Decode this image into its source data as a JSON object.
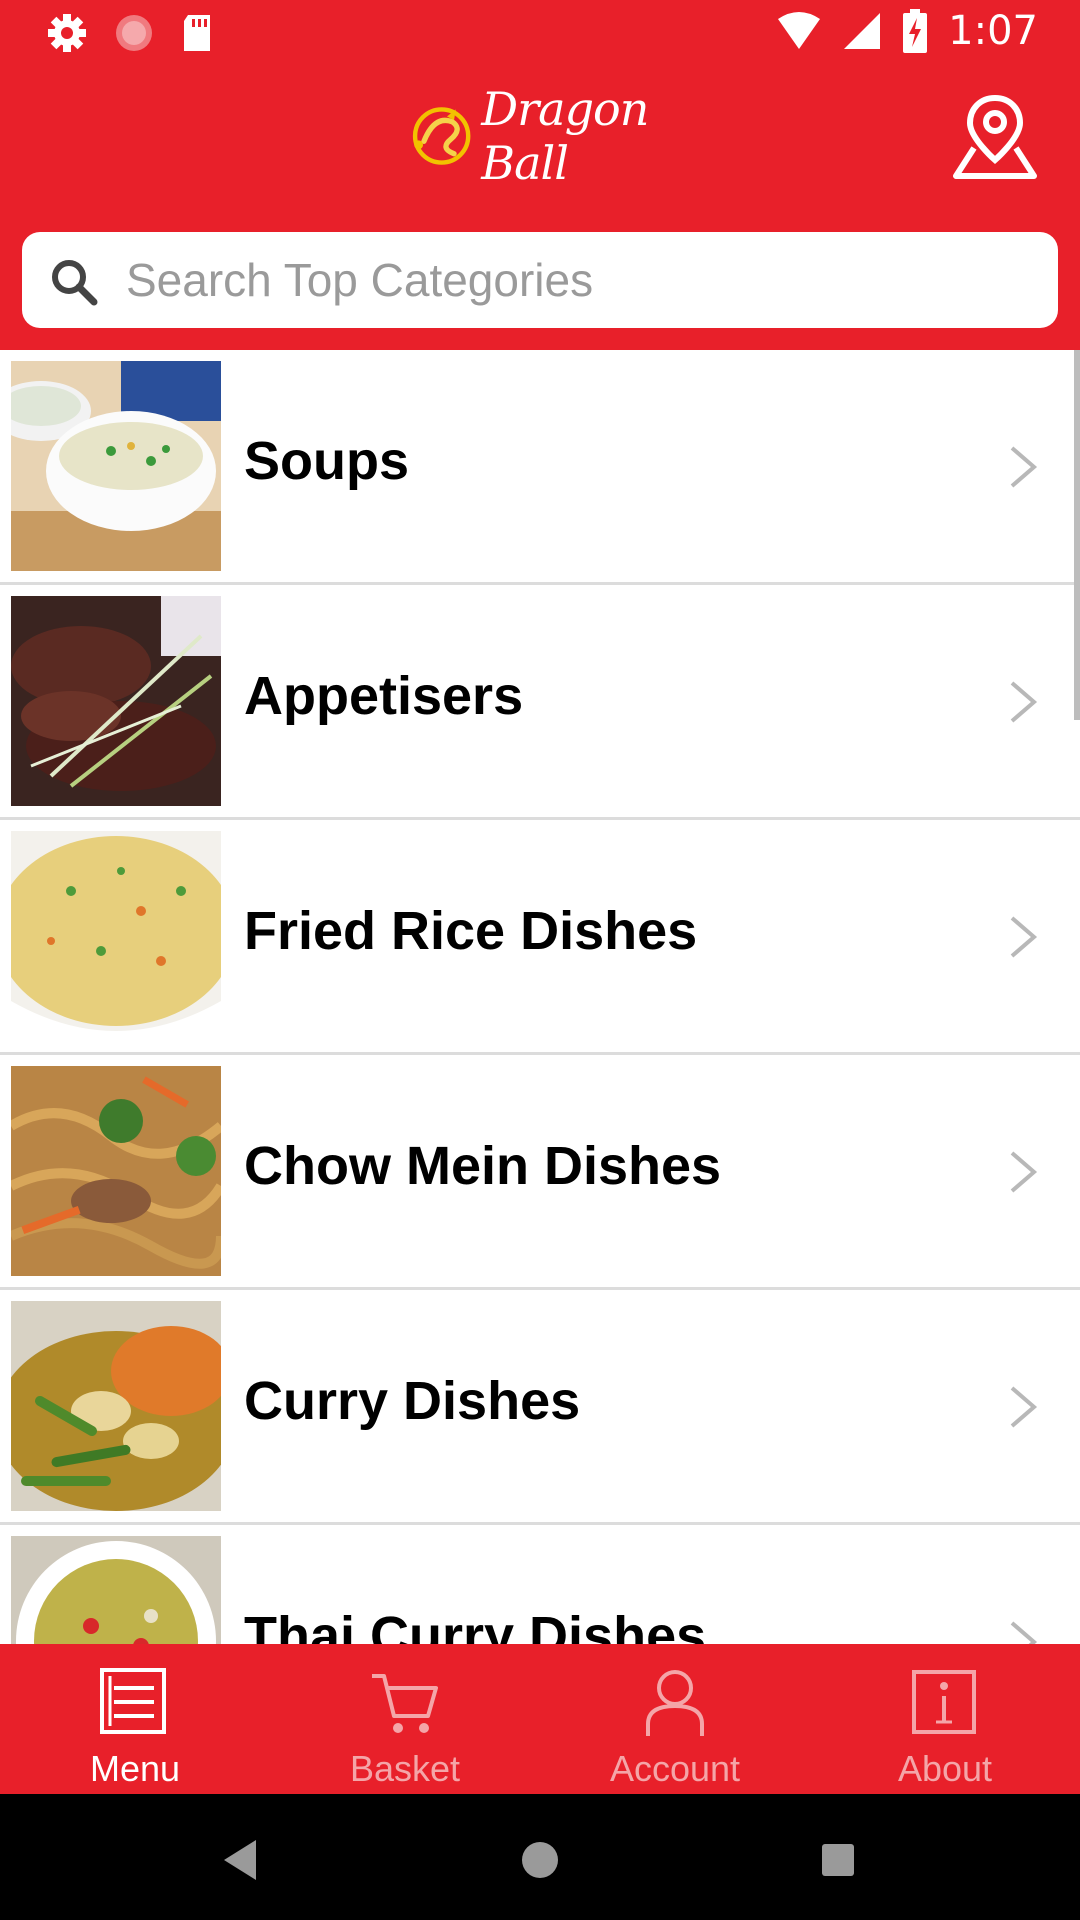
{
  "status_bar": {
    "time": "1:07",
    "icons": [
      "settings-icon",
      "record-icon",
      "sd-card-icon",
      "wifi-icon",
      "signal-icon",
      "battery-charging-icon"
    ]
  },
  "header": {
    "logo_text": "Dragon Ball",
    "location_icon": "location-pin-icon"
  },
  "search": {
    "placeholder": "Search Top Categories",
    "value": ""
  },
  "categories": [
    {
      "label": "Soups",
      "image": "soup-photo"
    },
    {
      "label": "Appetisers",
      "image": "ribs-photo"
    },
    {
      "label": "Fried Rice Dishes",
      "image": "fried-rice-photo"
    },
    {
      "label": "Chow Mein Dishes",
      "image": "chow-mein-photo"
    },
    {
      "label": "Curry Dishes",
      "image": "curry-photo"
    },
    {
      "label": "Thai Curry Dishes",
      "image": "thai-curry-photo"
    }
  ],
  "tabs": [
    {
      "label": "Menu",
      "icon": "menu-list-icon",
      "active": true
    },
    {
      "label": "Basket",
      "icon": "cart-icon",
      "active": false
    },
    {
      "label": "Account",
      "icon": "user-icon",
      "active": false
    },
    {
      "label": "About",
      "icon": "info-icon",
      "active": false
    }
  ],
  "colors": {
    "brand_red": "#e8202a",
    "inactive_tab": "#f4a5a8"
  }
}
